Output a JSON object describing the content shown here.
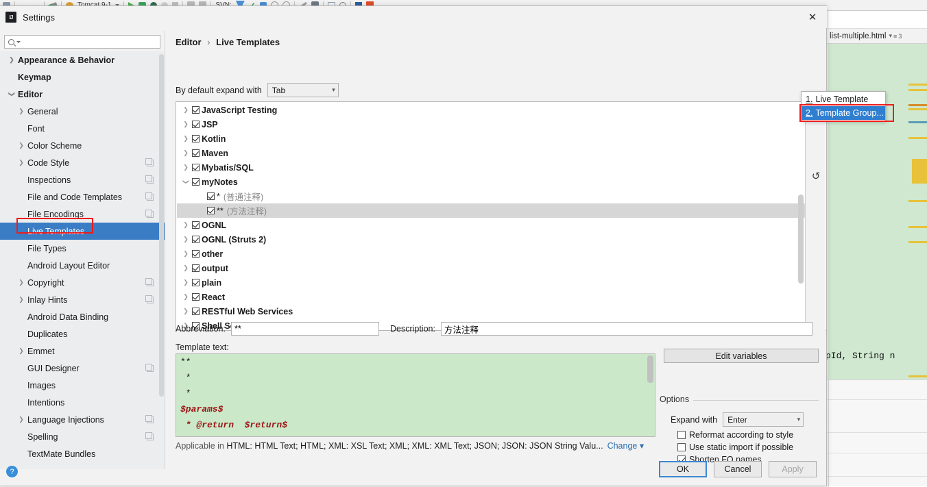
{
  "ide": {
    "toolbar": {
      "run_config": "Tomcat 9-1",
      "svn_label": "SVN:"
    },
    "editor_tab": {
      "filename": "list-multiple.html",
      "tab_badge": "3"
    },
    "code_snippet": "pId, String n"
  },
  "dialog": {
    "title": "Settings",
    "close_icon": "close-icon",
    "search": {
      "value": "",
      "placeholder": ""
    },
    "help_label": "?",
    "breadcrumb": {
      "root": "Editor",
      "separator": "›",
      "current": "Live Templates"
    },
    "expand_with": {
      "label": "By default expand with",
      "value": "Tab"
    },
    "buttons": {
      "ok": "OK",
      "cancel": "Cancel",
      "apply": "Apply"
    }
  },
  "sidebar": {
    "items": [
      {
        "label": "Appearance & Behavior",
        "level": 0,
        "twisty": "collapsed",
        "bold": true,
        "badge": false,
        "selected": false
      },
      {
        "label": "Keymap",
        "level": 0,
        "twisty": "none",
        "bold": true,
        "badge": false,
        "selected": false
      },
      {
        "label": "Editor",
        "level": 0,
        "twisty": "expanded",
        "bold": true,
        "badge": false,
        "selected": false
      },
      {
        "label": "General",
        "level": 1,
        "twisty": "collapsed",
        "bold": false,
        "badge": false,
        "selected": false
      },
      {
        "label": "Font",
        "level": 1,
        "twisty": "none",
        "bold": false,
        "badge": false,
        "selected": false
      },
      {
        "label": "Color Scheme",
        "level": 1,
        "twisty": "collapsed",
        "bold": false,
        "badge": false,
        "selected": false
      },
      {
        "label": "Code Style",
        "level": 1,
        "twisty": "collapsed",
        "bold": false,
        "badge": true,
        "selected": false
      },
      {
        "label": "Inspections",
        "level": 1,
        "twisty": "none",
        "bold": false,
        "badge": true,
        "selected": false
      },
      {
        "label": "File and Code Templates",
        "level": 1,
        "twisty": "none",
        "bold": false,
        "badge": true,
        "selected": false
      },
      {
        "label": "File Encodings",
        "level": 1,
        "twisty": "none",
        "bold": false,
        "badge": true,
        "selected": false
      },
      {
        "label": "Live Templates",
        "level": 1,
        "twisty": "none",
        "bold": false,
        "badge": false,
        "selected": true
      },
      {
        "label": "File Types",
        "level": 1,
        "twisty": "none",
        "bold": false,
        "badge": false,
        "selected": false
      },
      {
        "label": "Android Layout Editor",
        "level": 1,
        "twisty": "none",
        "bold": false,
        "badge": false,
        "selected": false
      },
      {
        "label": "Copyright",
        "level": 1,
        "twisty": "collapsed",
        "bold": false,
        "badge": true,
        "selected": false
      },
      {
        "label": "Inlay Hints",
        "level": 1,
        "twisty": "collapsed",
        "bold": false,
        "badge": true,
        "selected": false
      },
      {
        "label": "Android Data Binding",
        "level": 1,
        "twisty": "none",
        "bold": false,
        "badge": false,
        "selected": false
      },
      {
        "label": "Duplicates",
        "level": 1,
        "twisty": "none",
        "bold": false,
        "badge": false,
        "selected": false
      },
      {
        "label": "Emmet",
        "level": 1,
        "twisty": "collapsed",
        "bold": false,
        "badge": false,
        "selected": false
      },
      {
        "label": "GUI Designer",
        "level": 1,
        "twisty": "none",
        "bold": false,
        "badge": true,
        "selected": false
      },
      {
        "label": "Images",
        "level": 1,
        "twisty": "none",
        "bold": false,
        "badge": false,
        "selected": false
      },
      {
        "label": "Intentions",
        "level": 1,
        "twisty": "none",
        "bold": false,
        "badge": false,
        "selected": false
      },
      {
        "label": "Language Injections",
        "level": 1,
        "twisty": "collapsed",
        "bold": false,
        "badge": true,
        "selected": false
      },
      {
        "label": "Spelling",
        "level": 1,
        "twisty": "none",
        "bold": false,
        "badge": true,
        "selected": false
      },
      {
        "label": "TextMate Bundles",
        "level": 1,
        "twisty": "none",
        "bold": false,
        "badge": false,
        "selected": false
      }
    ]
  },
  "template_list": {
    "rows": [
      {
        "name": "JavaScript Testing",
        "desc": "",
        "twisty": "collapsed",
        "checked": true,
        "child": false,
        "selected": false
      },
      {
        "name": "JSP",
        "desc": "",
        "twisty": "collapsed",
        "checked": true,
        "child": false,
        "selected": false
      },
      {
        "name": "Kotlin",
        "desc": "",
        "twisty": "collapsed",
        "checked": true,
        "child": false,
        "selected": false
      },
      {
        "name": "Maven",
        "desc": "",
        "twisty": "collapsed",
        "checked": true,
        "child": false,
        "selected": false
      },
      {
        "name": "Mybatis/SQL",
        "desc": "",
        "twisty": "collapsed",
        "checked": true,
        "child": false,
        "selected": false
      },
      {
        "name": "myNotes",
        "desc": "",
        "twisty": "expanded",
        "checked": true,
        "child": false,
        "selected": false
      },
      {
        "name": "*",
        "desc": "(普通注释)",
        "twisty": "none",
        "checked": true,
        "child": true,
        "selected": false
      },
      {
        "name": "**",
        "desc": "(方法注释)",
        "twisty": "none",
        "checked": true,
        "child": true,
        "selected": true
      },
      {
        "name": "OGNL",
        "desc": "",
        "twisty": "collapsed",
        "checked": true,
        "child": false,
        "selected": false
      },
      {
        "name": "OGNL (Struts 2)",
        "desc": "",
        "twisty": "collapsed",
        "checked": true,
        "child": false,
        "selected": false
      },
      {
        "name": "other",
        "desc": "",
        "twisty": "collapsed",
        "checked": true,
        "child": false,
        "selected": false
      },
      {
        "name": "output",
        "desc": "",
        "twisty": "collapsed",
        "checked": true,
        "child": false,
        "selected": false
      },
      {
        "name": "plain",
        "desc": "",
        "twisty": "collapsed",
        "checked": true,
        "child": false,
        "selected": false
      },
      {
        "name": "React",
        "desc": "",
        "twisty": "collapsed",
        "checked": true,
        "child": false,
        "selected": false
      },
      {
        "name": "RESTful Web Services",
        "desc": "",
        "twisty": "collapsed",
        "checked": true,
        "child": false,
        "selected": false
      },
      {
        "name": "Shell Script",
        "desc": "",
        "twisty": "collapsed",
        "checked": true,
        "child": false,
        "selected": false
      }
    ],
    "add_button": "+",
    "revert_button": "↺"
  },
  "add_menu": {
    "items": [
      {
        "number": "1.",
        "label": "Live Template",
        "highlighted": false
      },
      {
        "number": "2.",
        "label": "Template Group...",
        "highlighted": true
      }
    ]
  },
  "form": {
    "abbreviation_label": "Abbreviation:",
    "abbreviation_value": "**",
    "description_label": "Description:",
    "description_value": "方法注释",
    "template_text_label": "Template text:",
    "template_lines": [
      {
        "text": "**",
        "var": false
      },
      {
        "text": " *",
        "var": false
      },
      {
        "text": " *",
        "var": false
      },
      {
        "text": "$params$",
        "var": true
      },
      {
        "text": " * @return  $return$",
        "var": true
      }
    ],
    "applicable_prefix": "Applicable in ",
    "applicable_value": "HTML: HTML Text; HTML; XML: XSL Text; XML; XML: XML Text; JSON; JSON: JSON String Valu...",
    "change_link": "Change",
    "edit_variables": "Edit variables"
  },
  "options": {
    "title": "Options",
    "expand_with_label": "Expand with",
    "expand_with_value": "Enter",
    "checkboxes": [
      {
        "label": "Reformat according to style",
        "checked": false
      },
      {
        "label": "Use static import if possible",
        "checked": false
      },
      {
        "label": "Shorten FQ names",
        "checked": true
      }
    ]
  },
  "colors": {
    "selection_blue": "#3a7dc5",
    "annotation_red": "#ee1c1c",
    "code_bg_green": "#cbe8c9",
    "variable_red": "#9b1515",
    "link_blue": "#2b6cb0"
  }
}
